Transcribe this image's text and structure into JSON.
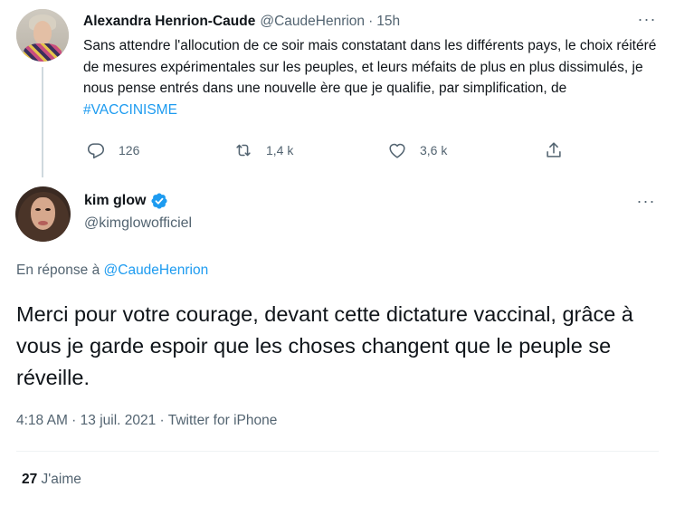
{
  "parent_tweet": {
    "author_name": "Alexandra Henrion-Caude",
    "author_handle": "@CaudeHenrion",
    "separator": "·",
    "time": "15h",
    "text_prefix": "Sans attendre l'allocution de ce soir mais constatant dans les différents pays, le choix réitéré de mesures expérimentales sur les peuples, et leurs méfaits de plus en plus dissimulés, je nous pense entrés dans une nouvelle ère que je qualifie, par simplification, de ",
    "hashtag": "#VACCINISME",
    "replies": "126",
    "retweets": "1,4 k",
    "likes": "3,6 k",
    "more_label": "···"
  },
  "main_tweet": {
    "author_name": "kim glow",
    "author_handle": "@kimglowofficiel",
    "verified": true,
    "reply_prefix": "En réponse à ",
    "reply_mention": "@CaudeHenrion",
    "text": "Merci pour votre courage, devant cette dictature vaccinal, grâce à vous je garde espoir que les choses changent que le peuple se réveille.",
    "meta": "4:18 AM · 13 juil. 2021 · Twitter for iPhone",
    "likes_count": "27",
    "likes_label": " J'aime",
    "more_label": "···"
  },
  "colors": {
    "accent": "#1d9bf0",
    "text_primary": "#0f1419",
    "text_secondary": "#536471",
    "thread_line": "#cfd9de"
  }
}
